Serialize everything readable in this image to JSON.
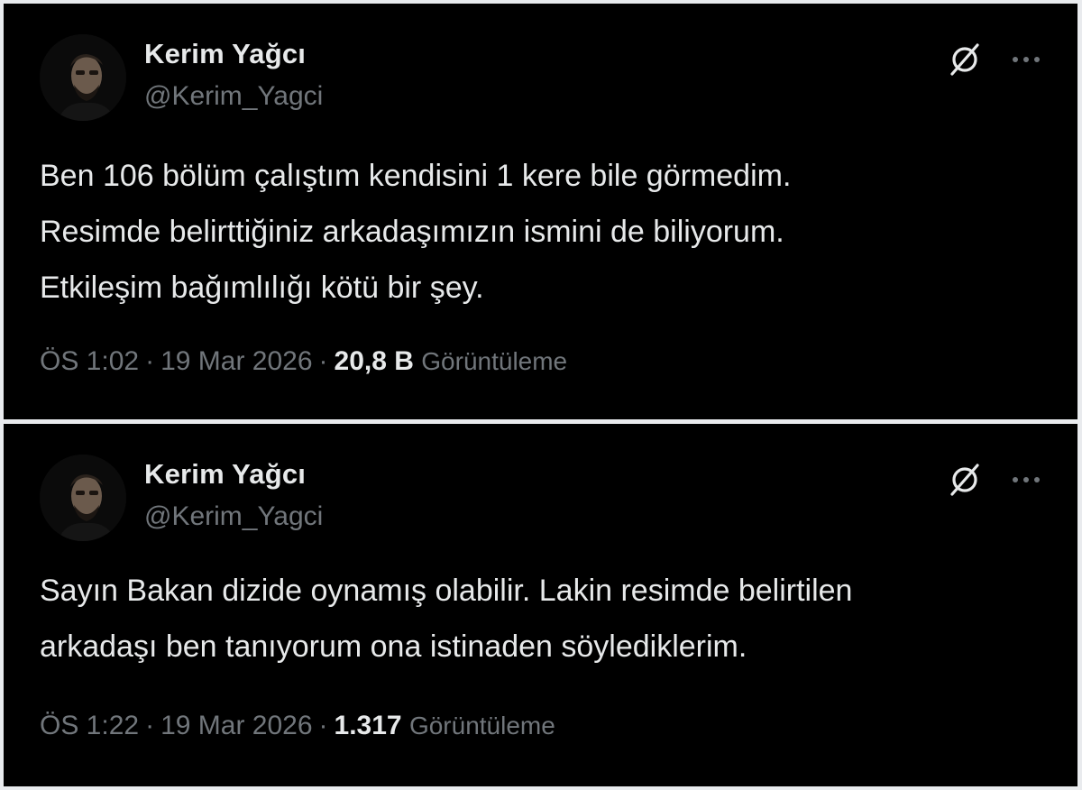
{
  "tweets": [
    {
      "author": {
        "name": "Kerim Yağcı",
        "handle": "@Kerim_Yagci"
      },
      "text": "Ben 106 bölüm çalıştım kendisini 1 kere bile görmedim.\nResimde belirttiğiniz arkadaşımızın ismini de biliyorum.\nEtkileşim bağımlılığı kötü bir şey.",
      "time": "ÖS 1:02",
      "separator": "·",
      "date": "19 Mar 2026",
      "views": "20,8 B",
      "views_label": "Görüntüleme",
      "icons": {
        "grok": "grok-icon",
        "more": "more-icon"
      }
    },
    {
      "author": {
        "name": "Kerim Yağcı",
        "handle": "@Kerim_Yagci"
      },
      "text": "Sayın Bakan dizide oynamış olabilir. Lakin resimde belirtilen\narkadaşı ben tanıyorum ona istinaden söylediklerim.",
      "time": "ÖS 1:22",
      "separator": "·",
      "date": "19 Mar 2026",
      "views": "1.317",
      "views_label": "Görüntüleme",
      "icons": {
        "grok": "grok-icon",
        "more": "more-icon"
      }
    }
  ],
  "colors": {
    "background": "#000000",
    "text_primary": "#e7e9ea",
    "text_secondary": "#71767b",
    "frame": "#e9ebee"
  }
}
